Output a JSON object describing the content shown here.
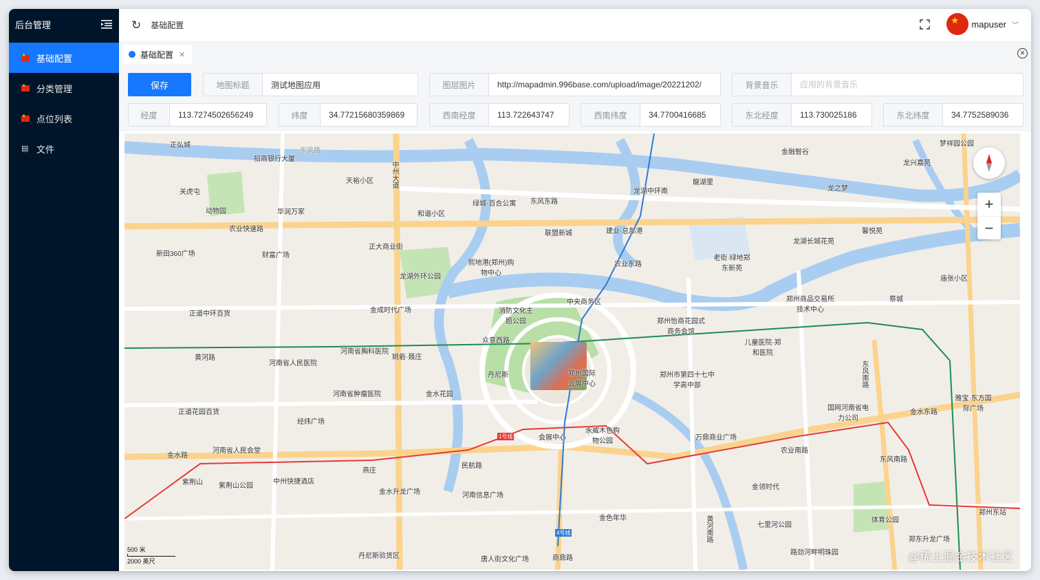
{
  "sidebar": {
    "title": "后台管理",
    "items": [
      {
        "label": "基础配置",
        "active": true
      },
      {
        "label": "分类管理",
        "active": false
      },
      {
        "label": "点位列表",
        "active": false
      },
      {
        "label": "文件",
        "active": false
      }
    ]
  },
  "header": {
    "breadcrumb": "基础配置",
    "username": "mapuser"
  },
  "tabs": [
    {
      "label": "基础配置"
    }
  ],
  "form": {
    "save_label": "保存",
    "map_title": {
      "label": "地图标题",
      "value": "测试地图应用"
    },
    "layer_image": {
      "label": "图层图片",
      "value": "http://mapadmin.996base.com/upload/image/20221202/"
    },
    "bg_music": {
      "label": "背景音乐",
      "placeholder": "应用的背景音乐"
    },
    "lng": {
      "label": "经度",
      "value": "113.7274502656249"
    },
    "lat": {
      "label": "纬度",
      "value": "34.77215680359869"
    },
    "sw_lng": {
      "label": "西南经度",
      "value": "113.722643747"
    },
    "sw_lat": {
      "label": "西南纬度",
      "value": "34.7700416685"
    },
    "ne_lng": {
      "label": "东北经度",
      "value": "113.730025186"
    },
    "ne_lat": {
      "label": "东北纬度",
      "value": "34.7752589036"
    }
  },
  "map": {
    "scale_metric": "500 米",
    "scale_imperial": "2000 英尺",
    "watermark": "@稀土掘金技术社区",
    "labels": [
      {
        "text": "正弘城"
      },
      {
        "text": "招商银行大厦"
      },
      {
        "text": "东风路"
      },
      {
        "text": "中州大道"
      },
      {
        "text": "天裕小区"
      },
      {
        "text": "关虎屯"
      },
      {
        "text": "动物园"
      },
      {
        "text": "华润万家"
      },
      {
        "text": "农业快速路"
      },
      {
        "text": "和谐小区"
      },
      {
        "text": "绿城·百合公寓"
      },
      {
        "text": "东风东路"
      },
      {
        "text": "龙湖中环南"
      },
      {
        "text": "龍湖里"
      },
      {
        "text": "金融智谷"
      },
      {
        "text": "龙兴嘉苑"
      },
      {
        "text": "梦祥园公园"
      },
      {
        "text": "龙之梦"
      },
      {
        "text": "新田360广场"
      },
      {
        "text": "财富广场"
      },
      {
        "text": "正大商业街"
      },
      {
        "text": "联盟新城"
      },
      {
        "text": "建业·总部港"
      },
      {
        "text": "农业东路"
      },
      {
        "text": "熙地港(郑州)购物中心"
      },
      {
        "text": "龙湖外环公园"
      },
      {
        "text": "龙湖长城花苑"
      },
      {
        "text": "馨悦苑"
      },
      {
        "text": "老街·绿地郑东新苑"
      },
      {
        "text": "庙张小区"
      },
      {
        "text": "正道中环百货"
      },
      {
        "text": "金成时代广场"
      },
      {
        "text": "消防文化主题公园"
      },
      {
        "text": "中央商务区"
      },
      {
        "text": "郑州怡商花园式商务会馆"
      },
      {
        "text": "郑州商品交易所技术中心"
      },
      {
        "text": "祭城"
      },
      {
        "text": "黄河路"
      },
      {
        "text": "河南省人民医院"
      },
      {
        "text": "河南省胸科医院"
      },
      {
        "text": "姚砦·聂庄"
      },
      {
        "text": "众意西路"
      },
      {
        "text": "儿童医院·郑和医院"
      },
      {
        "text": "丹尼斯"
      },
      {
        "text": "郑州国际会展中心"
      },
      {
        "text": "郑州市第四十七中学高中部"
      },
      {
        "text": "东风南路"
      },
      {
        "text": "河南省肿瘤医院"
      },
      {
        "text": "金水花园"
      },
      {
        "text": "正道花园百货"
      },
      {
        "text": "经纬广场"
      },
      {
        "text": "国网河南省电力公司"
      },
      {
        "text": "雅宝·东方国际广场"
      },
      {
        "text": "金水东路"
      },
      {
        "text": "河南省人民会堂"
      },
      {
        "text": "金水路"
      },
      {
        "text": "会展中心"
      },
      {
        "text": "永威木色购物公园"
      },
      {
        "text": "万鼎商业广场"
      },
      {
        "text": "农业南路"
      },
      {
        "text": "东风南路"
      },
      {
        "text": "燕庄"
      },
      {
        "text": "民航路"
      },
      {
        "text": "紫荆山"
      },
      {
        "text": "紫荆山公园"
      },
      {
        "text": "中州快捷酒店"
      },
      {
        "text": "金水升龙广场"
      },
      {
        "text": "河南信息广场"
      },
      {
        "text": "黄河南路"
      },
      {
        "text": "金领时代"
      },
      {
        "text": "金色年华"
      },
      {
        "text": "七里河公园"
      },
      {
        "text": "体育公园"
      },
      {
        "text": "郑州东站"
      },
      {
        "text": "郑东升龙广场"
      },
      {
        "text": "丹尼斯验货区"
      },
      {
        "text": "唐人街文化广场"
      },
      {
        "text": "商鼎路"
      },
      {
        "text": "路劲河畔明珠园"
      },
      {
        "text": "1号线"
      },
      {
        "text": "4号线"
      }
    ]
  }
}
